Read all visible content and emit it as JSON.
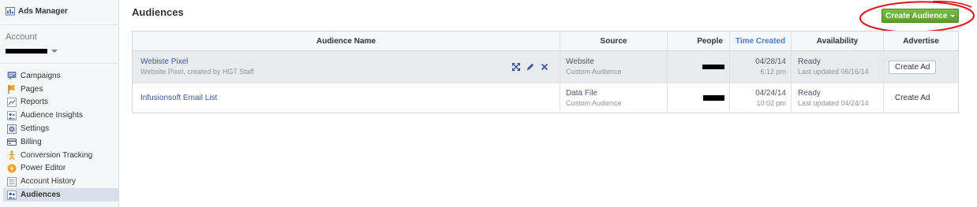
{
  "sidebar": {
    "app_title": "Ads Manager",
    "app_icon": "ads-manager-icon",
    "account_label": "Account",
    "account_dropdown_icon": "caret-down-icon",
    "items": [
      {
        "label": "Campaigns",
        "icon": "campaigns-icon"
      },
      {
        "label": "Pages",
        "icon": "pages-icon"
      },
      {
        "label": "Reports",
        "icon": "reports-icon"
      },
      {
        "label": "Audience Insights",
        "icon": "audience-insights-icon"
      },
      {
        "label": "Settings",
        "icon": "settings-icon"
      },
      {
        "label": "Billing",
        "icon": "billing-icon"
      },
      {
        "label": "Conversion Tracking",
        "icon": "conversion-tracking-icon"
      },
      {
        "label": "Power Editor",
        "icon": "power-editor-icon"
      },
      {
        "label": "Account History",
        "icon": "account-history-icon"
      },
      {
        "label": "Audiences",
        "icon": "audiences-icon",
        "selected": true
      }
    ]
  },
  "header": {
    "title": "Audiences",
    "create_button_label": "Create Audience",
    "create_button_icon": "caret-down-icon"
  },
  "table": {
    "columns": [
      {
        "label": "Audience Name"
      },
      {
        "label": "Source"
      },
      {
        "label": "People"
      },
      {
        "label": "Time Created",
        "sorted": true
      },
      {
        "label": "Availability"
      },
      {
        "label": "Advertise"
      }
    ],
    "rows": [
      {
        "name": "Webiste Pixel",
        "description": "Website Pixel, created by HGT Staff",
        "source": "Website",
        "source_type": "Custom Audience",
        "date": "04/28/14",
        "time": "6:12 pm",
        "availability": "Ready",
        "last_updated": "Last updated 06/16/14",
        "advertise": "Create Ad",
        "highlighted": true,
        "action_icons": [
          "expand-icon",
          "pencil-icon",
          "close-icon"
        ]
      },
      {
        "name": "Infusionsoft Email List",
        "source": "Data File",
        "source_type": "Custom Audience",
        "date": "04/24/14",
        "time": "10:02 pm",
        "availability": "Ready",
        "last_updated": "Last updated 04/24/14",
        "advertise": "Create Ad"
      }
    ]
  },
  "colors": {
    "link": "#3b5998",
    "create_button": "#5fac2f",
    "annotation": "#e3101c",
    "selected_nav": "#d8dfea",
    "row_highlight": "#e9eaed",
    "sorted_header": "#4a7bd0"
  }
}
